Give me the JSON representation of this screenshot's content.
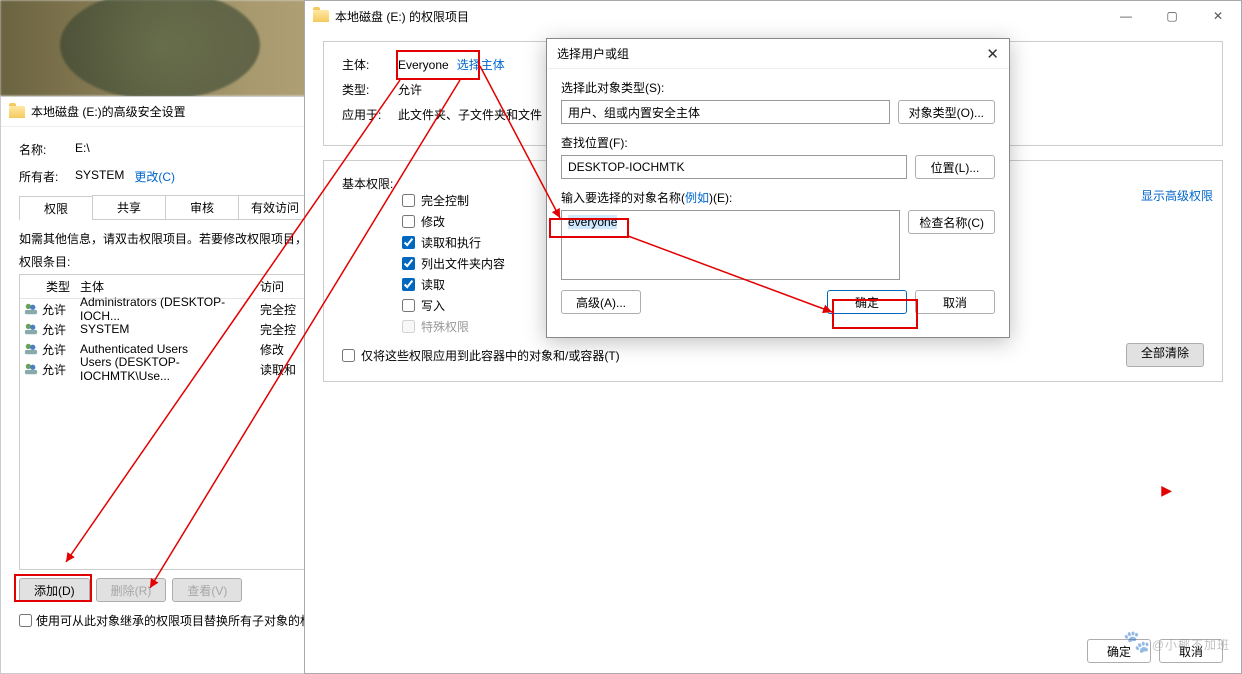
{
  "bgWindow": {
    "title": "本地磁盘 (E:)的高级安全设置",
    "nameLabel": "名称:",
    "nameValue": "E:\\",
    "ownerLabel": "所有者:",
    "ownerValue": "SYSTEM",
    "changeLink": "更改(C)",
    "tabs": [
      "权限",
      "共享",
      "审核",
      "有效访问"
    ],
    "infoText": "如需其他信息，请双击权限项目。若要修改权限项目，请选择",
    "permHeader": "权限条目:",
    "columns": {
      "type": "类型",
      "subject": "主体",
      "access": "访问"
    },
    "rows": [
      {
        "type": "允许",
        "subject": "Administrators (DESKTOP-IOCH...",
        "access": "完全控"
      },
      {
        "type": "允许",
        "subject": "SYSTEM",
        "access": "完全控"
      },
      {
        "type": "允许",
        "subject": "Authenticated Users",
        "access": "修改"
      },
      {
        "type": "允许",
        "subject": "Users (DESKTOP-IOCHMTK\\Use...",
        "access": "读取和"
      }
    ],
    "addBtn": "添加(D)",
    "removeBtn": "删除(R)",
    "viewBtn": "查看(V)",
    "replaceCb": "使用可从此对象继承的权限项目替换所有子对象的权限"
  },
  "midWindow": {
    "title": "本地磁盘 (E:) 的权限项目",
    "subjectLabel": "主体:",
    "subjectValue": "Everyone",
    "selectLink": "选择主体",
    "typeLabel": "类型:",
    "typeValue": "允许",
    "applyLabel": "应用于:",
    "applyValue": "此文件夹、子文件夹和文件",
    "basicPermLabel": "基本权限:",
    "perms": {
      "fullControl": "完全控制",
      "modify": "修改",
      "readExec": "读取和执行",
      "listFolder": "列出文件夹内容",
      "read": "读取",
      "write": "写入",
      "special": "特殊权限"
    },
    "advancedLink": "显示高级权限",
    "applyOnlyCb": "仅将这些权限应用到此容器中的对象和/或容器(T)",
    "clearAllBtn": "全部清除",
    "okBtn": "确定",
    "cancelBtn": "取消"
  },
  "topDialog": {
    "title": "选择用户或组",
    "objTypeLabel": "选择此对象类型(S):",
    "objTypeValue": "用户、组或内置安全主体",
    "objTypeBtn": "对象类型(O)...",
    "locLabel": "查找位置(F):",
    "locValue": "DESKTOP-IOCHMTK",
    "locBtn": "位置(L)...",
    "nameLabel": "输入要选择的对象名称(",
    "nameExample": "例如",
    "nameLabelEnd": ")(E):",
    "nameValue": "everyone",
    "checkBtn": "检查名称(C)",
    "advBtn": "高级(A)...",
    "okBtn": "确定",
    "cancelBtn": "取消"
  },
  "watermark": "@小椰不加班"
}
